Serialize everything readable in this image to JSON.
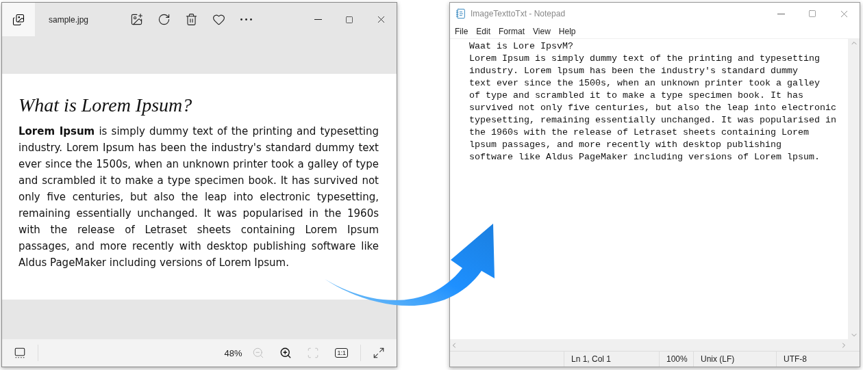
{
  "photo_viewer": {
    "title": "sample.jpg",
    "document": {
      "heading": "What is Lorem Ipsum?",
      "body": "**Lorem Ipsum** is simply dummy text of the printing and typesetting industry. Lorem Ipsum has been the industry's standard dummy text ever since the 1500s, when an unknown printer took a galley of type and scrambled it to make a type specimen book. It has survived not only five centuries, but also the leap into electronic typesetting, remaining essentially unchanged. It was popularised in the 1960s with the release of Letraset sheets containing Lorem Ipsum passages, and more recently with desktop publishing software like Aldus PageMaker including versions of Lorem Ipsum."
    },
    "zoom": "48%",
    "bottom_tools": [
      {
        "kind": "zoom-out",
        "disabled": true
      },
      {
        "kind": "zoom-in",
        "disabled": false
      },
      {
        "kind": "fit",
        "disabled": true
      },
      {
        "kind": "actual-size",
        "label": "1:1",
        "disabled": false
      }
    ]
  },
  "notepad": {
    "title": "ImageTexttoTxt - Notepad",
    "menu": [
      "File",
      "Edit",
      "Format",
      "View",
      "Help"
    ],
    "lines": [
      "Waat is Lore IpsvM?",
      "Lorem Ipsum is simply dummy text of the printing and typesetting",
      "industry. Lorem lpsum has been the industry's standard dummy",
      "text ever since the 1500s, when an unknown printer took a galley",
      "of type and scrambled it to make a type specimen book. It has",
      "survived not only five centuries, but also the leap into electronic",
      "typesetting, remaining essentially unchanged. It was popularised in",
      "the 1960s with the release of Letraset sheets containing Lorem",
      "lpsum passages, and more recently with desktop publishing",
      "software like Aldus PageMaker including versions of Lorem lpsum."
    ],
    "status": [
      "Ln 1, Col 1",
      "100%",
      "Unix (LF)",
      "UTF-8"
    ]
  }
}
